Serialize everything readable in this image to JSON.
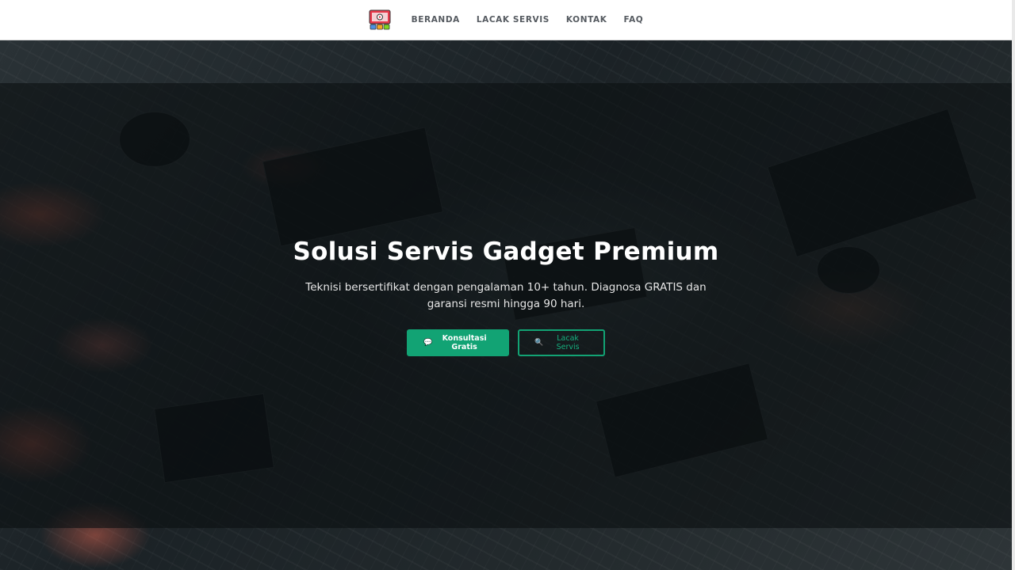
{
  "navbar": {
    "logo_icon": "repair-monitor-logo-icon",
    "links": [
      {
        "label": "BERANDA"
      },
      {
        "label": "LACAK SERVIS"
      },
      {
        "label": "KONTAK"
      },
      {
        "label": "FAQ"
      }
    ]
  },
  "hero": {
    "title": "Solusi Servis Gadget Premium",
    "subtitle": "Teknisi bersertifikat dengan pengalaman 10+ tahun. Diagnosa GRATIS dan garansi resmi hingga 90 hari.",
    "primary_button": {
      "icon": "chat-bubble-icon",
      "glyph": "💬",
      "label": "Konsultasi Gratis"
    },
    "secondary_button": {
      "icon": "magnifier-icon",
      "glyph": "🔍",
      "label": "Lacak Servis"
    }
  },
  "colors": {
    "accent": "#12a374",
    "navbar_bg": "#ffffff",
    "nav_text": "#555a60"
  }
}
